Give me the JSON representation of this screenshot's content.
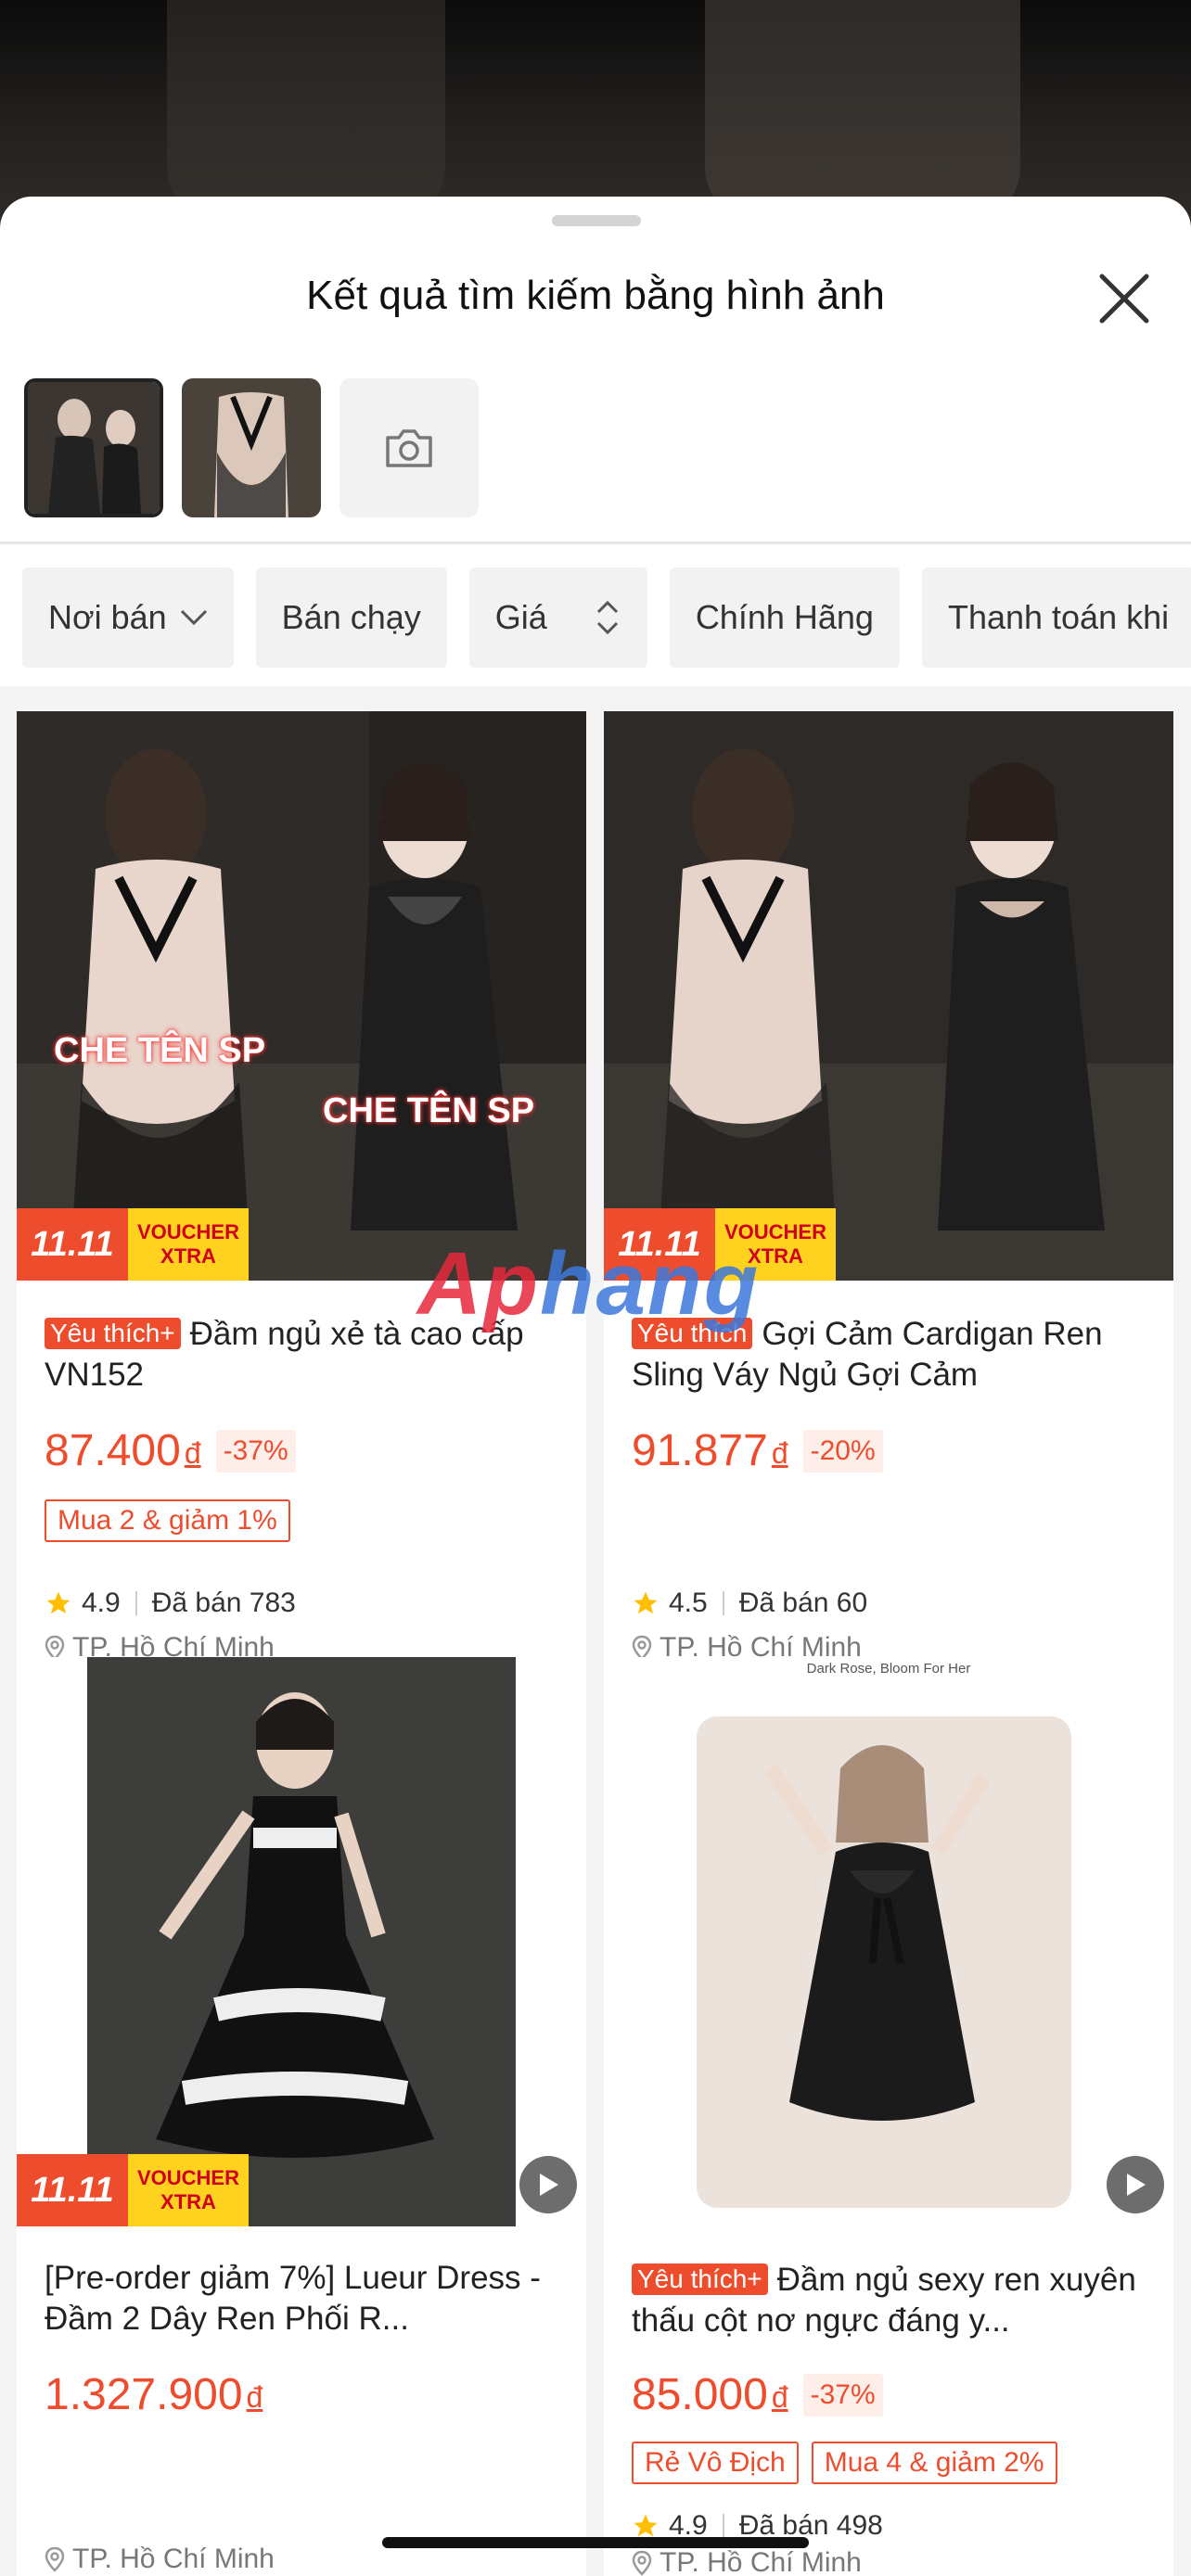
{
  "sheet": {
    "title": "Kết quả tìm kiếm bằng hình ảnh"
  },
  "filters": [
    "Nơi bán",
    "Bán chạy",
    "Giá",
    "Chính Hãng",
    "Thanh toán khi"
  ],
  "products": [
    {
      "tag": "Yêu thích+",
      "name": "Đầm ngủ xẻ tà cao cấp VN152",
      "price": "87.400",
      "currency": "đ",
      "discount": "-37%",
      "promos": [
        "Mua 2 & giảm 1%"
      ],
      "rating": "4.9",
      "sold": "Đã bán 783",
      "location": "TP. Hồ Chí Minh",
      "image_text": [
        "CHE TÊN SP",
        "CHE TÊN SP"
      ]
    },
    {
      "tag": "Yêu thích",
      "name": "Gợi Cảm Cardigan Ren Sling Váy Ngủ Gợi Cảm",
      "price": "91.877",
      "currency": "đ",
      "discount": "-20%",
      "promos": [],
      "rating": "4.5",
      "sold": "Đã bán 60",
      "location": "TP. Hồ Chí Minh"
    },
    {
      "tag": "",
      "name": "[Pre-order giảm 7%] Lueur Dress - Đầm 2 Dây Ren Phối R...",
      "price": "1.327.900",
      "currency": "đ",
      "discount": "",
      "promos": [],
      "rating": "",
      "sold": "",
      "location": "TP. Hồ Chí Minh"
    },
    {
      "tag": "Yêu thích+",
      "name": "Đầm ngủ sexy ren xuyên thấu cột nơ ngực đáng y...",
      "price": "85.000",
      "currency": "đ",
      "discount": "-37%",
      "promos": [
        "Rẻ Vô Địch",
        "Mua 4 & giảm 2%"
      ],
      "rating": "4.9",
      "sold": "Đã bán 498",
      "location": "TP. Hồ Chí Minh",
      "image_caption": "Dark Rose, Bloom For Her"
    }
  ],
  "badges": {
    "event": "11.11",
    "voucher_top": "VOUCHER",
    "voucher_bottom": "XTRA"
  },
  "watermark": {
    "part1": "Ap",
    "part2": "hang"
  },
  "colors": {
    "accent": "#ee4d2d",
    "voucher_yellow": "#ffd21f"
  }
}
